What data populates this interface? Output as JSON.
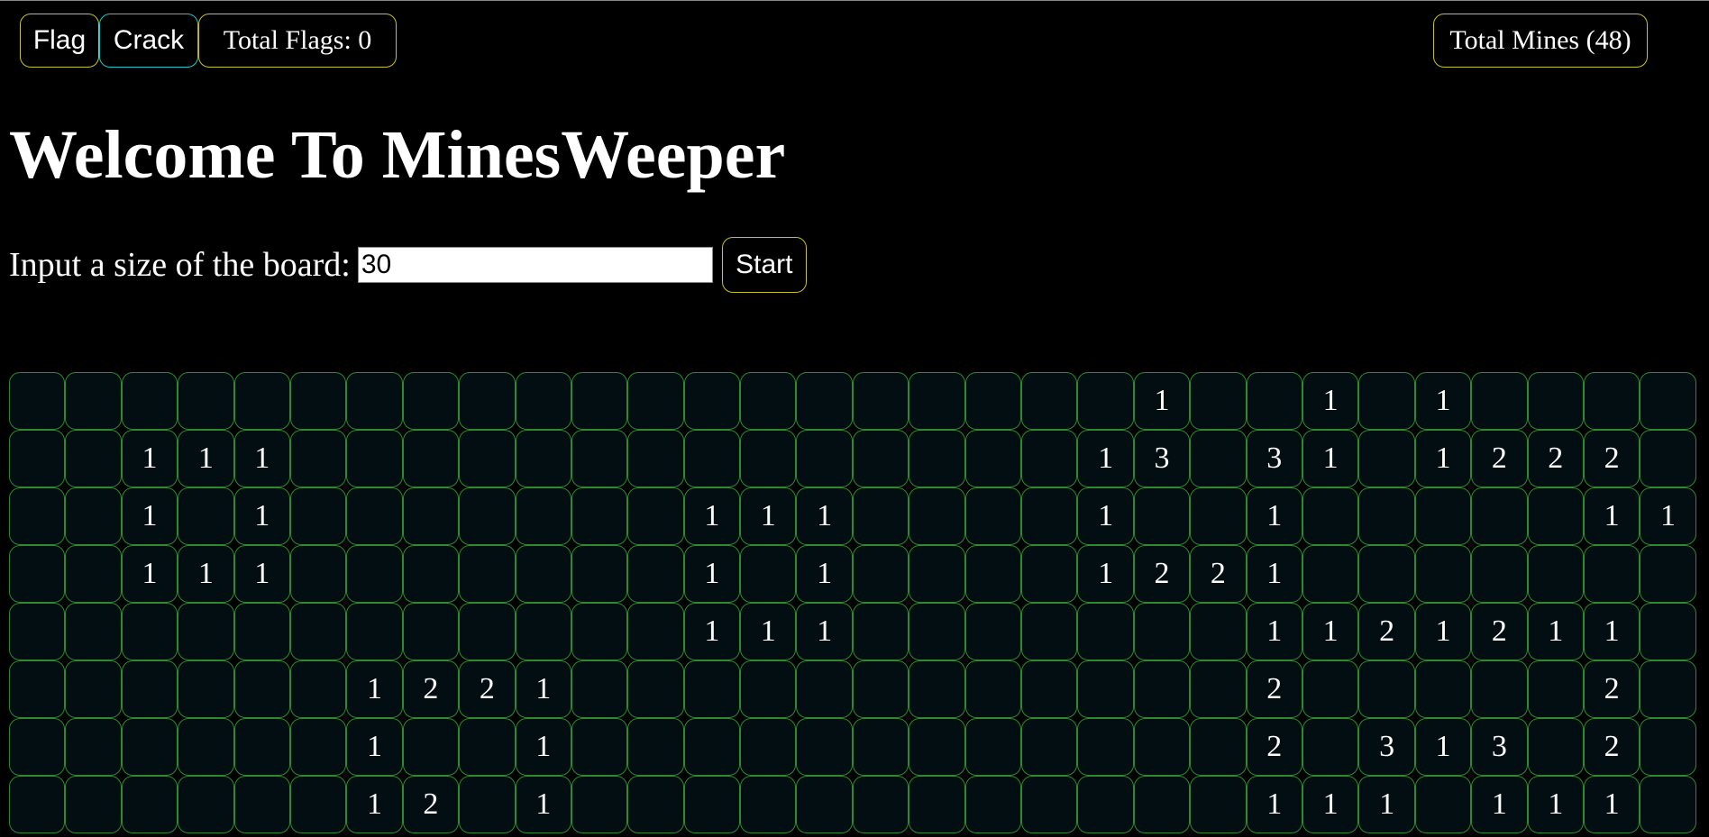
{
  "toolbar": {
    "flag_label": "Flag",
    "crack_label": "Crack",
    "flags_label": "Total Flags: 0",
    "mines_label": "Total Mines (48)"
  },
  "title": "Welcome To MinesWeeper",
  "size_input": {
    "label": "Input a size of the board:",
    "value": "30"
  },
  "start_label": "Start",
  "board": {
    "columns": 30,
    "rows": [
      [
        "",
        "",
        "",
        "",
        "",
        "",
        "",
        "",
        "",
        "",
        "",
        "",
        "",
        "",
        "",
        "",
        "",
        "",
        "",
        "",
        "1",
        "",
        "",
        "1",
        "",
        "1",
        "",
        "",
        "",
        ""
      ],
      [
        "",
        "",
        "1",
        "1",
        "1",
        "",
        "",
        "",
        "",
        "",
        "",
        "",
        "",
        "",
        "",
        "",
        "",
        "",
        "",
        "1",
        "3",
        "",
        "3",
        "1",
        "",
        "1",
        "2",
        "2",
        "2",
        ""
      ],
      [
        "",
        "",
        "1",
        "",
        "1",
        "",
        "",
        "",
        "",
        "",
        "",
        "",
        "1",
        "1",
        "1",
        "",
        "",
        "",
        "",
        "1",
        "",
        "",
        "1",
        "",
        "",
        "",
        "",
        "",
        "1",
        "1"
      ],
      [
        "",
        "",
        "1",
        "1",
        "1",
        "",
        "",
        "",
        "",
        "",
        "",
        "",
        "1",
        "",
        "1",
        "",
        "",
        "",
        "",
        "1",
        "2",
        "2",
        "1",
        "",
        "",
        "",
        "",
        "",
        "",
        ""
      ],
      [
        "",
        "",
        "",
        "",
        "",
        "",
        "",
        "",
        "",
        "",
        "",
        "",
        "1",
        "1",
        "1",
        "",
        "",
        "",
        "",
        "",
        "",
        "",
        "1",
        "1",
        "2",
        "1",
        "2",
        "1",
        "1",
        ""
      ],
      [
        "",
        "",
        "",
        "",
        "",
        "",
        "1",
        "2",
        "2",
        "1",
        "",
        "",
        "",
        "",
        "",
        "",
        "",
        "",
        "",
        "",
        "",
        "",
        "2",
        "",
        "",
        "",
        "",
        "",
        "2",
        ""
      ],
      [
        "",
        "",
        "",
        "",
        "",
        "",
        "1",
        "",
        "",
        "1",
        "",
        "",
        "",
        "",
        "",
        "",
        "",
        "",
        "",
        "",
        "",
        "",
        "2",
        "",
        "3",
        "1",
        "3",
        "",
        "2",
        ""
      ],
      [
        "",
        "",
        "",
        "",
        "",
        "",
        "1",
        "2",
        "",
        "1",
        "",
        "",
        "",
        "",
        "",
        "",
        "",
        "",
        "",
        "",
        "",
        "",
        "1",
        "1",
        "1",
        "",
        "1",
        "1",
        "1",
        ""
      ]
    ]
  },
  "colors": {
    "accent_yellow": "#c9c21e",
    "accent_cyan": "#1ec9c9",
    "cell_border": "#2e8a2e",
    "cell_bg": "#030e12"
  }
}
